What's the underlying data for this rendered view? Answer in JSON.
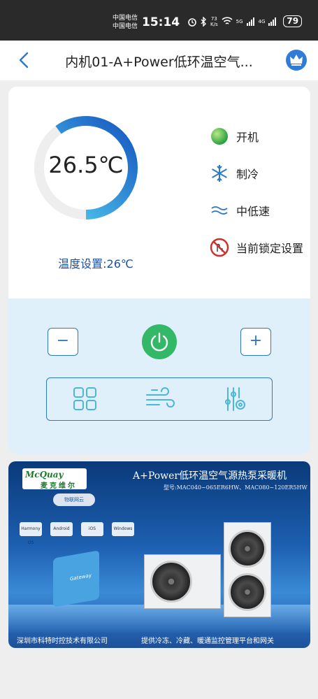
{
  "status_bar": {
    "carrier_1": "中国电信",
    "carrier_2": "中国电信",
    "time": "15:14",
    "net_speed_value": "73",
    "net_speed_unit": "K/s",
    "signal_1": "5G",
    "signal_2": "4G",
    "battery": "79"
  },
  "nav": {
    "title": "内机01-A+Power低环温空气..."
  },
  "thermostat": {
    "current_temp": "26.5℃",
    "setpoint_label": "温度设置:26℃",
    "progress_fraction": 0.6,
    "colors": {
      "arc_start": "#1554c0",
      "arc_end": "#55d6f2",
      "track": "#eeeeee"
    }
  },
  "status": {
    "power": {
      "label": "开机",
      "icon": "power-on-indicator-icon",
      "color": "#3cb24a"
    },
    "mode": {
      "label": "制冷",
      "icon": "snowflake-icon",
      "color": "#2e78c8"
    },
    "fan": {
      "label": "中低速",
      "icon": "wind-icon",
      "color": "#2e78c8"
    },
    "lock": {
      "label": "当前锁定设置",
      "icon": "no-touch-icon",
      "color": "#d42b2b"
    }
  },
  "controls": {
    "minus": "−",
    "plus": "+",
    "power_color": "#33b867",
    "mode_buttons": [
      "grid-menu-icon",
      "wind-mode-icon",
      "settings-sliders-icon"
    ]
  },
  "banner": {
    "brand": "McQuay",
    "brand_cn": "麦克维尔",
    "title": "A+Power低环温空气源热泵采暖机",
    "model": "型号:MAC040~065ER6HW、MAC080~120ER5HW",
    "cloud_label": "物联网云",
    "os_labels": [
      "Harmony OS",
      "Android",
      "iOS",
      "Windows"
    ],
    "gateway_label": "Gateway",
    "company": "深圳市科特时控技术有限公司",
    "services": "提供冷冻、冷藏、暖通监控管理平台和网关"
  }
}
